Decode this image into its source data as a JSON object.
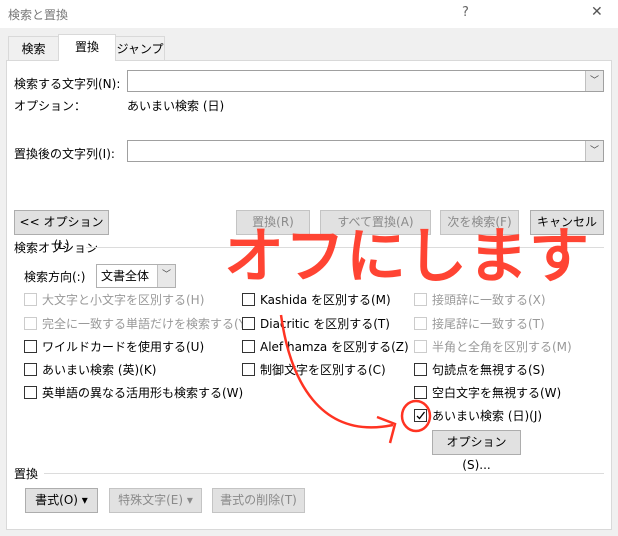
{
  "window": {
    "title": "検索と置換",
    "help": "?",
    "close": "✕"
  },
  "tabs": [
    {
      "label": "検索"
    },
    {
      "label": "置換"
    },
    {
      "label": "ジャンプ"
    }
  ],
  "find": {
    "label": "検索する文字列(N):",
    "value": "",
    "options_label": "オプション：",
    "options_value": "あいまい検索 (日)"
  },
  "replace": {
    "label": "置換後の文字列(I):",
    "value": ""
  },
  "buttons": {
    "less": "<< オプション(L)",
    "replace": "置換(R)",
    "replace_all": "すべて置換(A)",
    "find_next": "次を検索(F)",
    "cancel": "キャンセル"
  },
  "search_options": {
    "heading": "検索オプション",
    "direction_label": "検索方向(:)",
    "direction_value": "文書全体",
    "checkboxes": [
      {
        "label": "大文字と小文字を区別する(H)",
        "checked": false,
        "disabled": true
      },
      {
        "label": "完全に一致する単語だけを検索する(Y)",
        "checked": false,
        "disabled": true
      },
      {
        "label": "ワイルドカードを使用する(U)",
        "checked": false,
        "disabled": false
      },
      {
        "label": "あいまい検索 (英)(K)",
        "checked": false,
        "disabled": false
      },
      {
        "label": "英単語の異なる活用形も検索する(W)",
        "checked": false,
        "disabled": false
      },
      {
        "label": "Kashida を区別する(M)",
        "checked": false,
        "disabled": false
      },
      {
        "label": "Diacritic を区別する(T)",
        "checked": false,
        "disabled": false
      },
      {
        "label": "Alef hamza を区別する(Z)",
        "checked": false,
        "disabled": false
      },
      {
        "label": "制御文字を区別する(C)",
        "checked": false,
        "disabled": false
      },
      {
        "label": "接頭辞に一致する(X)",
        "checked": false,
        "disabled": true
      },
      {
        "label": "接尾辞に一致する(T)",
        "checked": false,
        "disabled": true
      },
      {
        "label": "半角と全角を区別する(M)",
        "checked": false,
        "disabled": true
      },
      {
        "label": "句読点を無視する(S)",
        "checked": false,
        "disabled": false
      },
      {
        "label": "空白文字を無視する(W)",
        "checked": false,
        "disabled": false
      },
      {
        "label": "あいまい検索 (日)(J)",
        "checked": true,
        "disabled": false
      }
    ],
    "options_button": "オプション(S)..."
  },
  "replace_section": {
    "heading": "置換",
    "format": "書式(O) ▾",
    "special": "特殊文字(E) ▾",
    "no_format": "書式の削除(T)"
  },
  "annotation": {
    "text": "オフにします",
    "color": "#ff4433"
  }
}
